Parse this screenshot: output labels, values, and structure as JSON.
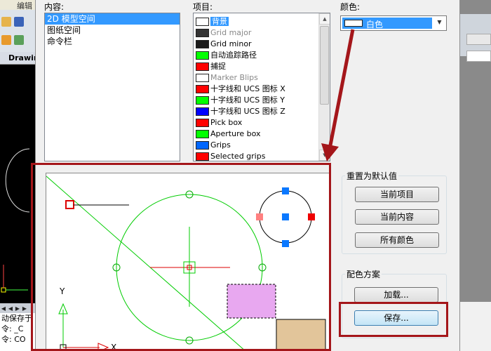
{
  "background_app": {
    "menu_text": "编辑",
    "tab_label": "Drawin",
    "command_lines": [
      "动保存于",
      "令:  _C",
      "令:  CO"
    ]
  },
  "dialog": {
    "context_label": "内容:",
    "context_items": [
      {
        "label": "2D 模型空间",
        "selected": true
      },
      {
        "label": "图纸空间",
        "selected": false
      },
      {
        "label": "命令栏",
        "selected": false
      }
    ],
    "items_label": "项目:",
    "items": [
      {
        "label": "背景",
        "color": "#ffffff",
        "selected": true,
        "gray": false
      },
      {
        "label": "Grid major",
        "color": "#333333",
        "selected": false,
        "gray": true
      },
      {
        "label": "Grid minor",
        "color": "#1a1a1a",
        "selected": false,
        "gray": false
      },
      {
        "label": "自动追踪路径",
        "color": "#00ff00",
        "selected": false,
        "gray": false
      },
      {
        "label": "捕捉",
        "color": "#ff0000",
        "selected": false,
        "gray": false
      },
      {
        "label": "Marker Blips",
        "color": "#ffffff",
        "selected": false,
        "gray": true
      },
      {
        "label": "十字线和 UCS 图标 X",
        "color": "#ff0000",
        "selected": false,
        "gray": false
      },
      {
        "label": "十字线和 UCS 图标 Y",
        "color": "#00ff00",
        "selected": false,
        "gray": false
      },
      {
        "label": "十字线和 UCS 图标 Z",
        "color": "#0000ff",
        "selected": false,
        "gray": false
      },
      {
        "label": "Pick box",
        "color": "#ff0000",
        "selected": false,
        "gray": false
      },
      {
        "label": "Aperture box",
        "color": "#00ff00",
        "selected": false,
        "gray": false
      },
      {
        "label": "Grips",
        "color": "#0066ff",
        "selected": false,
        "gray": false
      },
      {
        "label": "Selected grips",
        "color": "#ff0000",
        "selected": false,
        "gray": false
      }
    ],
    "color_label": "颜色:",
    "color_value": "白色",
    "preview": {
      "axis_y_label": "Y",
      "axis_x_label": "X"
    },
    "restore_group": {
      "title": "重置为默认值",
      "current_item_button": "当前项目",
      "current_context_button": "当前内容",
      "all_colors_button": "所有颜色"
    },
    "scheme_group": {
      "title": "配色方案",
      "load_button": "加载...",
      "save_button": "保存..."
    }
  },
  "annotation_color": "#a4161a"
}
